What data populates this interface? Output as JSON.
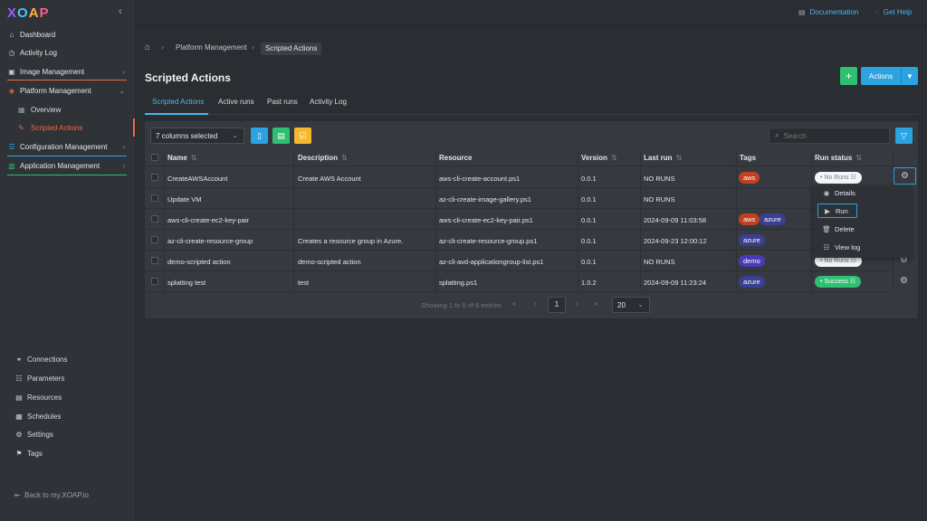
{
  "logo": "XOAP",
  "sidebar": {
    "collapse_icon": "chevron-left-icon",
    "items": [
      {
        "label": "Dashboard",
        "icon": "home-icon"
      },
      {
        "label": "Activity Log",
        "icon": "clock-icon"
      },
      {
        "label": "Image Management",
        "icon": "image-icon"
      },
      {
        "label": "Platform Management",
        "icon": "layers-icon"
      },
      {
        "label": "Configuration Management",
        "icon": "sliders-icon"
      },
      {
        "label": "Application Management",
        "icon": "chart-icon"
      }
    ],
    "sub_items": [
      {
        "label": "Overview",
        "icon": "grid-icon"
      },
      {
        "label": "Scripted Actions",
        "icon": "pen-icon"
      }
    ],
    "underline_colors": [
      "#f06b3a",
      "#2aa3e0",
      "#2fbf71"
    ],
    "bottom_items": [
      {
        "label": "Connections",
        "icon": "link-icon"
      },
      {
        "label": "Parameters",
        "icon": "list-icon"
      },
      {
        "label": "Resources",
        "icon": "box-icon"
      },
      {
        "label": "Schedules",
        "icon": "calendar-icon"
      },
      {
        "label": "Settings",
        "icon": "gear-icon"
      },
      {
        "label": "Tags",
        "icon": "bookmark-icon"
      }
    ],
    "back_link": "Back to my.XOAP.io"
  },
  "topbar": {
    "documentation": "Documentation",
    "help": "Get Help"
  },
  "breadcrumb": [
    "Platform Management",
    "Scripted Actions"
  ],
  "page": {
    "title": "Scripted Actions",
    "add_label": "+",
    "actions_label": "Actions"
  },
  "tabs": [
    "Scripted Actions",
    "Active runs",
    "Past runs",
    "Activity Log"
  ],
  "toolbar": {
    "columns_selected": "7 columns selected",
    "search_placeholder": "Search",
    "button_colors": [
      "#2aa3e0",
      "#2fbf71",
      "#f5b82e"
    ]
  },
  "table": {
    "headers": [
      "Name",
      "Description",
      "Resource",
      "Version",
      "Last run",
      "Tags",
      "Run status"
    ],
    "rows": [
      {
        "name": "CreateAWSAccount",
        "description": "Create AWS Account",
        "resource": "aws-cli-create-account.ps1",
        "version": "0.0.1",
        "last_run": "NO RUNS",
        "tags": [
          "aws"
        ],
        "status": "No Runs"
      },
      {
        "name": "Update VM",
        "description": "",
        "resource": "az-cli-create-image-gallery.ps1",
        "version": "0.0.1",
        "last_run": "NO RUNS",
        "tags": [],
        "status": ""
      },
      {
        "name": "aws-cli-create-ec2-key-pair",
        "description": "",
        "resource": "aws-cli-create-ec2-key-pair.ps1",
        "version": "0.0.1",
        "last_run": "2024-09-09 11:03:58",
        "tags": [
          "aws",
          "azure"
        ],
        "status": ""
      },
      {
        "name": "az-cli-create-resource-group",
        "description": "Creates a resource group in Azure.",
        "resource": "az-cli-create-resource-group.ps1",
        "version": "0.0.1",
        "last_run": "2024-09-23 12:00:12",
        "tags": [
          "azure"
        ],
        "status": ""
      },
      {
        "name": "demo-scripted action",
        "description": "demo-scripted action",
        "resource": "az-cli-avd-applicationgroup-list.ps1",
        "version": "0.0.1",
        "last_run": "NO RUNS",
        "tags": [
          "demo"
        ],
        "status": "No Runs"
      },
      {
        "name": "splatting test",
        "description": "test",
        "resource": "splatting.ps1",
        "version": "1.0.2",
        "last_run": "2024-09-09 11:23:24",
        "tags": [
          "azure"
        ],
        "status": "Success"
      }
    ],
    "tag_colors": {
      "aws": "#c2401f",
      "azure": "#3a3f8f",
      "demo": "#4b39b8"
    }
  },
  "context_menu": [
    {
      "label": "Details",
      "icon": "eye-icon"
    },
    {
      "label": "Run",
      "icon": "play-icon"
    },
    {
      "label": "Delete",
      "icon": "trash-icon"
    },
    {
      "label": "View log",
      "icon": "log-icon"
    }
  ],
  "pagination": {
    "info": "Showing 1 to 6 of 6 entries",
    "current_page": "1",
    "page_size": "20"
  }
}
